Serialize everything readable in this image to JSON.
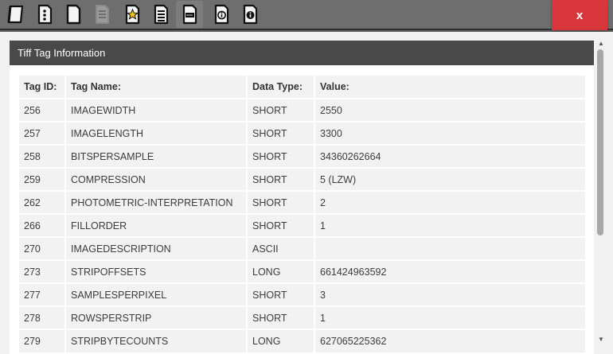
{
  "toolbar": {
    "close_label": "x",
    "icons": [
      "page-slanted-icon",
      "page-dots-icon",
      "page-blank-icon",
      "page-lines-disabled-icon",
      "page-star-icon",
      "page-list-icon",
      "page-drive-icon",
      "page-info-icon",
      "page-info-filled-icon"
    ]
  },
  "panel": {
    "title": "Tiff Tag Information"
  },
  "table": {
    "headers": {
      "tag_id": "Tag ID:",
      "tag_name": "Tag Name:",
      "data_type": "Data Type:",
      "value": "Value:"
    },
    "rows": [
      {
        "id": "256",
        "name": "IMAGEWIDTH",
        "type": "SHORT",
        "value": "2550"
      },
      {
        "id": "257",
        "name": "IMAGELENGTH",
        "type": "SHORT",
        "value": "3300"
      },
      {
        "id": "258",
        "name": "BITSPERSAMPLE",
        "type": "SHORT",
        "value": "34360262664"
      },
      {
        "id": "259",
        "name": "COMPRESSION",
        "type": "SHORT",
        "value": "5 (LZW)"
      },
      {
        "id": "262",
        "name": "PHOTOMETRIC-INTERPRETATION",
        "type": "SHORT",
        "value": "2"
      },
      {
        "id": "266",
        "name": "FILLORDER",
        "type": "SHORT",
        "value": "1"
      },
      {
        "id": "270",
        "name": "IMAGEDESCRIPTION",
        "type": "ASCII",
        "value": ""
      },
      {
        "id": "273",
        "name": "STRIPOFFSETS",
        "type": "LONG",
        "value": "661424963592"
      },
      {
        "id": "277",
        "name": "SAMPLESPERPIXEL",
        "type": "SHORT",
        "value": "3"
      },
      {
        "id": "278",
        "name": "ROWSPERSTRIP",
        "type": "SHORT",
        "value": "1"
      },
      {
        "id": "279",
        "name": "STRIPBYTECOUNTS",
        "type": "LONG",
        "value": "627065225362"
      }
    ]
  },
  "colors": {
    "close": "#d7373a",
    "title_bar": "#494949",
    "toolbar": "#6e6e6e"
  }
}
